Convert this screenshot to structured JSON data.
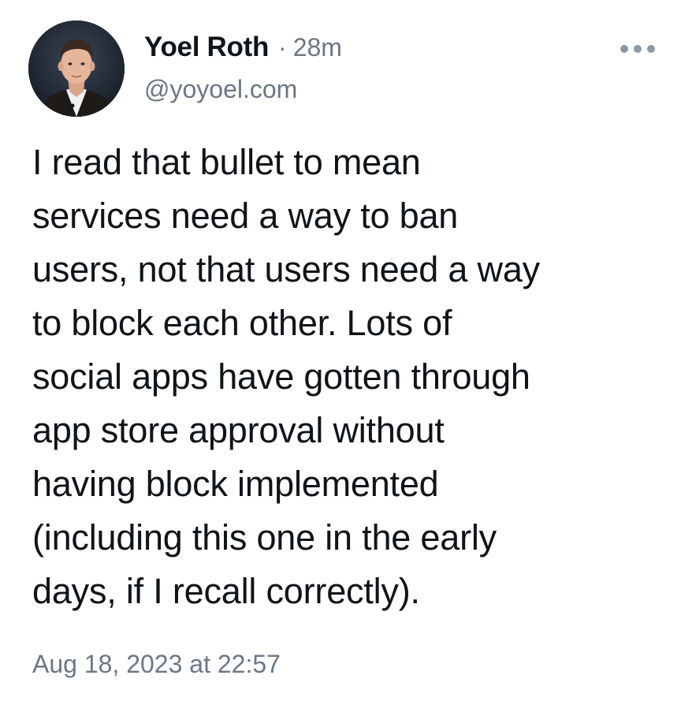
{
  "author": {
    "display_name": "Yoel Roth",
    "separator": "·",
    "time_ago": "28m",
    "handle": "@yoyoel.com",
    "avatar_icon": "profile-photo"
  },
  "post": {
    "lines": [
      "I read that bullet to mean",
      "services need a way to ban",
      "users, not that users need a way",
      "to block each other. Lots of",
      "social apps have gotten through",
      "app store approval without",
      "having block implemented",
      "(including this one in the early",
      "days, if I recall correctly)."
    ],
    "timestamp": "Aug 18, 2023 at 22:57"
  },
  "menu": {
    "icon": "more-options-icon"
  },
  "colors": {
    "text": "#0f1419",
    "secondary": "#6b7785",
    "background": "#ffffff"
  }
}
